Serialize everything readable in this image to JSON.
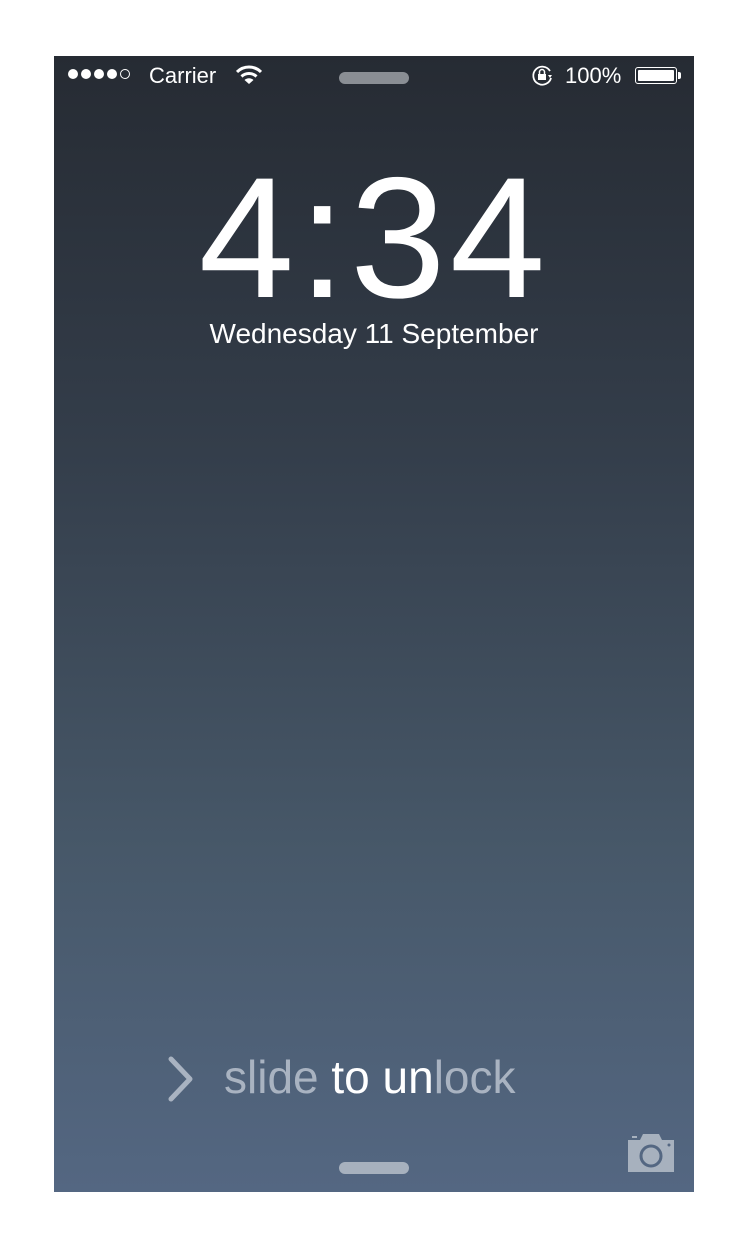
{
  "status_bar": {
    "signal_bars_filled": 4,
    "signal_bars_total": 5,
    "carrier": "Carrier",
    "battery_percent": "100%",
    "battery_level": 1.0
  },
  "lock_screen": {
    "time": "4:34",
    "date": "Wednesday 11 September",
    "slide_prefix": "slide ",
    "slide_highlight": "to un",
    "slide_suffix": "lock"
  },
  "icons": [
    "wifi-icon",
    "rotation-lock-icon",
    "battery-icon",
    "chevron-right-icon",
    "camera-icon"
  ],
  "colors": {
    "top": "#262b33",
    "bottom": "#546782",
    "slide_text": "#a9b3c1"
  }
}
